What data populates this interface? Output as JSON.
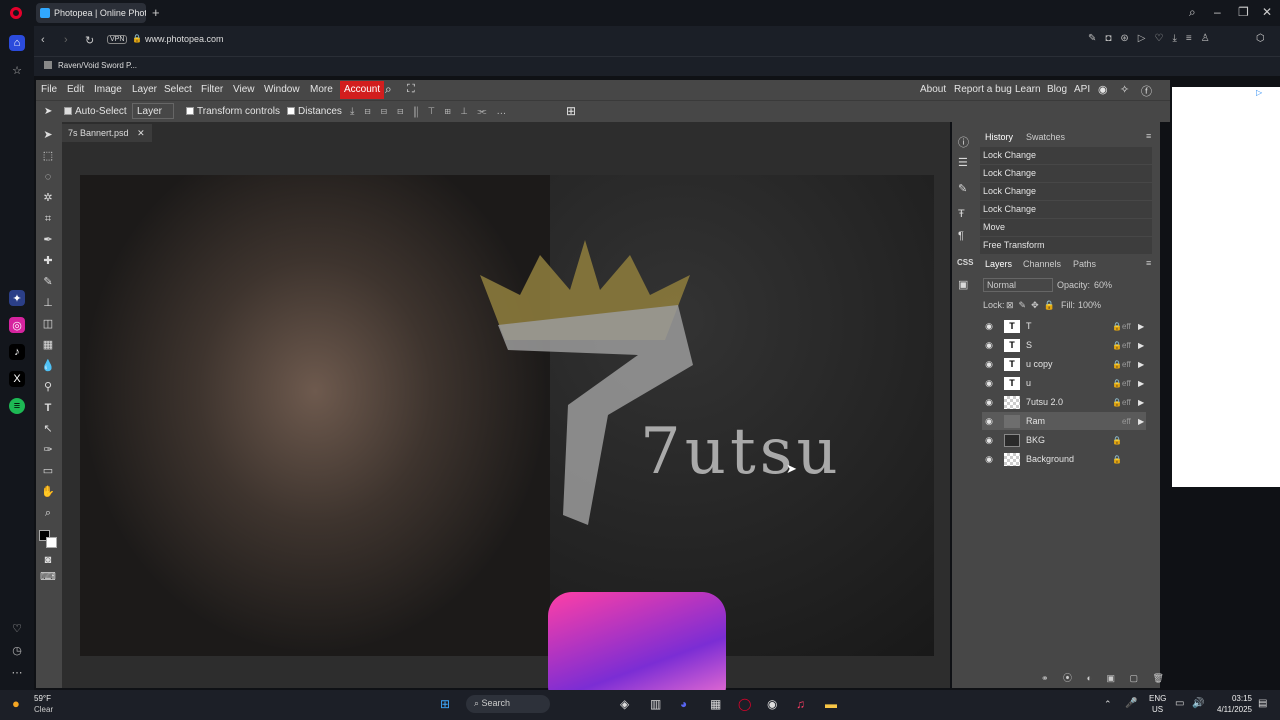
{
  "browser": {
    "tab_title": "Photopea | Online Photo",
    "url": "www.photopea.com",
    "vpn": "VPN",
    "bookmark": "Raven/Void Sword P...",
    "new_tab": "+"
  },
  "menu": {
    "items": [
      "File",
      "Edit",
      "Image",
      "Layer",
      "Select",
      "Filter",
      "View",
      "Window",
      "More"
    ],
    "account": "Account",
    "right": [
      "About",
      "Report a bug",
      "Learn",
      "Blog",
      "API"
    ]
  },
  "options": {
    "auto_select": "Auto-Select",
    "layer_dropdown": "Layer",
    "transform_controls": "Transform controls",
    "distances": "Distances"
  },
  "document": {
    "tab": "7s Bannert.psd",
    "logo_text": "7utsu"
  },
  "history": {
    "tab_history": "History",
    "tab_swatches": "Swatches",
    "entries": [
      "Lock Change",
      "Lock Change",
      "Lock Change",
      "Lock Change",
      "Move",
      "Free Transform"
    ]
  },
  "layers_panel": {
    "tab_layers": "Layers",
    "tab_channels": "Channels",
    "tab_paths": "Paths",
    "blend_mode": "Normal",
    "opacity_label": "Opacity:",
    "opacity_value": "60%",
    "lock_label": "Lock:",
    "fill_label": "Fill:",
    "fill_value": "100%",
    "layers": [
      {
        "name": "T",
        "type": "text",
        "fx": "eff"
      },
      {
        "name": "S",
        "type": "text",
        "fx": "eff"
      },
      {
        "name": "u copy",
        "type": "text",
        "fx": "eff"
      },
      {
        "name": "u",
        "type": "text",
        "fx": "eff"
      },
      {
        "name": "7utsu 2.0",
        "type": "smart",
        "fx": "eff"
      },
      {
        "name": "Ram",
        "type": "image",
        "fx": "eff"
      },
      {
        "name": "BKG",
        "type": "image",
        "fx": ""
      },
      {
        "name": "Background",
        "type": "image",
        "fx": ""
      }
    ]
  },
  "taskbar": {
    "weather_temp": "59°F",
    "weather_desc": "Clear",
    "search": "Search",
    "lang1": "ENG",
    "lang2": "US",
    "time": "03:15",
    "date": "4/11/2025"
  }
}
